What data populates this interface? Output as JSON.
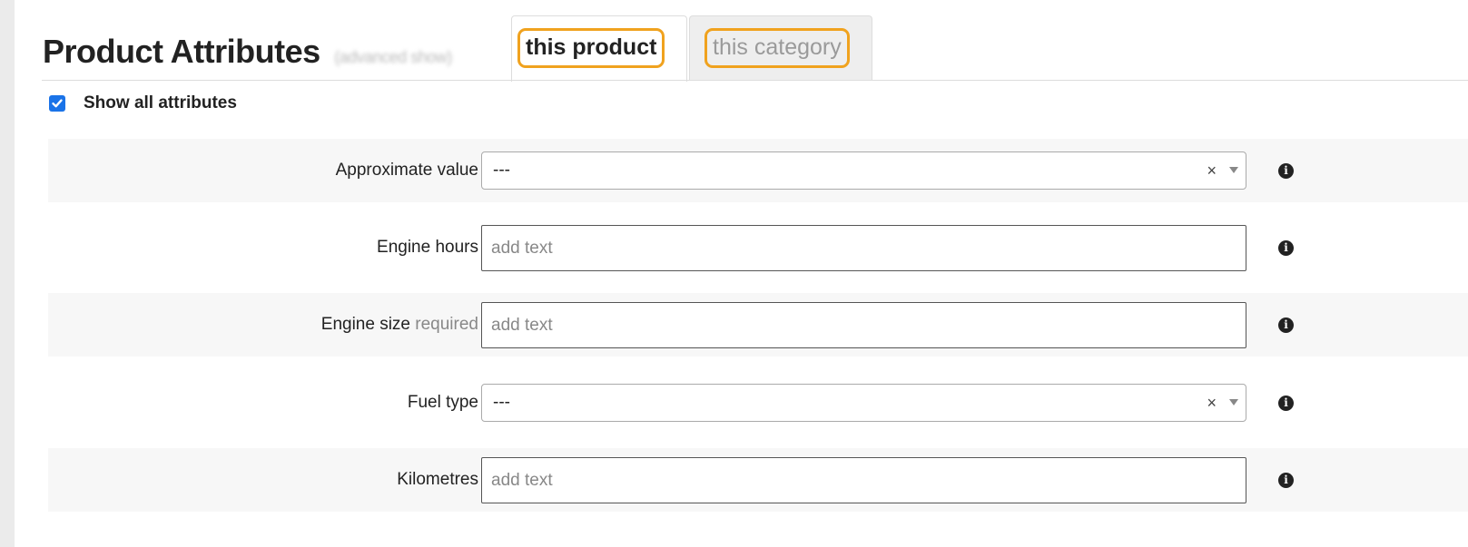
{
  "header": {
    "title": "Product Attributes",
    "title_hint": "(advanced show)"
  },
  "tabs": [
    {
      "label": "this product",
      "active": true
    },
    {
      "label": "this category",
      "active": false
    }
  ],
  "show_all": {
    "label": "Show all attributes",
    "checked": true
  },
  "attributes": [
    {
      "label": "Approximate value",
      "suffix": "",
      "type": "select",
      "value": "---"
    },
    {
      "label": "Engine hours",
      "suffix": "",
      "type": "text",
      "placeholder": "add text"
    },
    {
      "label": "Engine size",
      "suffix": "required",
      "type": "text",
      "placeholder": "add text"
    },
    {
      "label": "Fuel type",
      "suffix": "",
      "type": "select",
      "value": "---"
    },
    {
      "label": "Kilometres",
      "suffix": "",
      "type": "text",
      "placeholder": "add text"
    }
  ],
  "icons": {
    "info": "info-icon",
    "clear": "clear-icon",
    "dropdown": "chevron-down-icon",
    "check": "check-icon"
  },
  "colors": {
    "highlight": "#f0a21e",
    "checkbox": "#1a73e8",
    "row_shade": "#f7f7f7"
  }
}
